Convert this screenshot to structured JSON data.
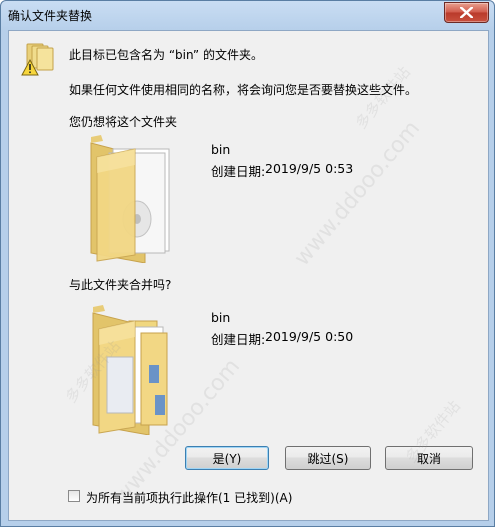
{
  "window": {
    "title": "确认文件夹替换",
    "close_icon": "close-icon"
  },
  "message": {
    "line1": "此目标已包含名为 “bin” 的文件夹。",
    "line2": "如果任何文件使用相同的名称，将会询问您是否要替换这些文件。",
    "line3": "您仍想将这个文件夹",
    "line4": "与此文件夹合并吗?"
  },
  "target_folder": {
    "name": "bin",
    "created_label": "创建日期:",
    "created_value": "2019/9/5 0:53"
  },
  "source_folder": {
    "name": "bin",
    "created_label": "创建日期:",
    "created_value": "2019/9/5 0:50"
  },
  "buttons": {
    "yes": "是(Y)",
    "skip": "跳过(S)",
    "cancel": "取消"
  },
  "checkbox": {
    "label": "为所有当前项执行此操作(1 已找到)(A)",
    "checked": false
  },
  "watermark": {
    "url": "www.ddooo.com",
    "site": "多多软件站"
  }
}
